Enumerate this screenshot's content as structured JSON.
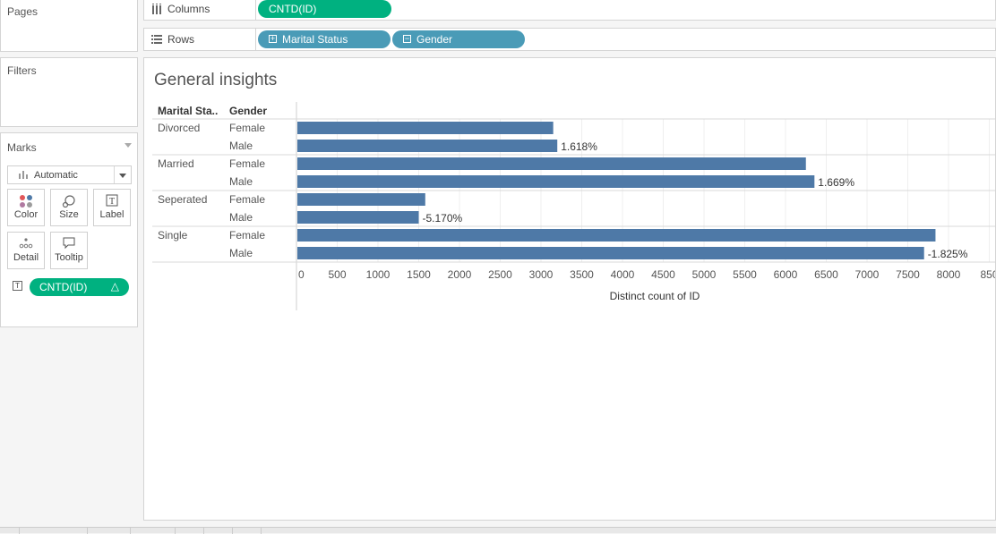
{
  "panels": {
    "pages": "Pages",
    "filters": "Filters",
    "marks": "Marks",
    "mark_type": "Automatic",
    "buttons": [
      "Color",
      "Size",
      "Label",
      "Detail",
      "Tooltip"
    ],
    "marks_pill": "CNTD(ID)",
    "marks_pill_delta": "△"
  },
  "shelves": {
    "columns_label": "Columns",
    "rows_label": "Rows",
    "columns_pills": [
      "CNTD(ID)"
    ],
    "rows_pills": [
      "Marital Status",
      "Gender"
    ],
    "rows_pill_toggles": [
      "+",
      "−"
    ]
  },
  "sheet": {
    "title": "General insights"
  },
  "chart_data": {
    "type": "bar",
    "orientation": "horizontal",
    "row_headers": [
      "Marital Sta..",
      "Gender"
    ],
    "groups": [
      {
        "label": "Divorced",
        "rows": [
          {
            "gender": "Female",
            "value": 3150,
            "label": ""
          },
          {
            "gender": "Male",
            "value": 3200,
            "label": "1.618%"
          }
        ]
      },
      {
        "label": "Married",
        "rows": [
          {
            "gender": "Female",
            "value": 6250,
            "label": ""
          },
          {
            "gender": "Male",
            "value": 6355,
            "label": "1.669%"
          }
        ]
      },
      {
        "label": "Seperated",
        "rows": [
          {
            "gender": "Female",
            "value": 1580,
            "label": ""
          },
          {
            "gender": "Male",
            "value": 1500,
            "label": "-5.170%"
          }
        ]
      },
      {
        "label": "Single",
        "rows": [
          {
            "gender": "Female",
            "value": 7840,
            "label": ""
          },
          {
            "gender": "Male",
            "value": 7700,
            "label": "-1.825%"
          }
        ]
      }
    ],
    "x_ticks": [
      "0",
      "500",
      "1000",
      "1500",
      "2000",
      "2500",
      "3000",
      "3500",
      "4000",
      "4500",
      "5000",
      "5500",
      "6000",
      "6500",
      "7000",
      "7500",
      "8000",
      "850"
    ],
    "xlabel": "Distinct count of ID",
    "xlim": [
      0,
      8500
    ],
    "bar_color": "#4e79a7",
    "grid": true
  },
  "colors": {
    "green_pill": "#00b180",
    "blue_pill": "#4a9bb7"
  }
}
